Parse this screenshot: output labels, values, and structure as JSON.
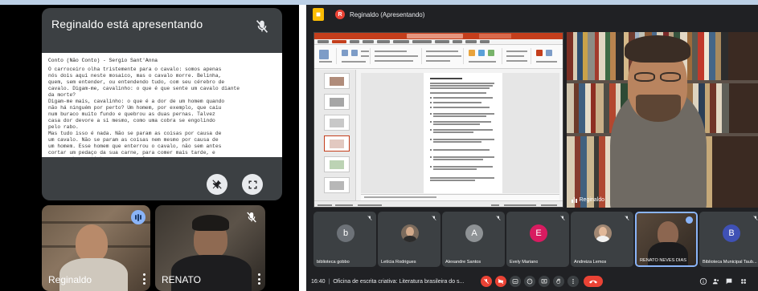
{
  "mobile": {
    "presenter_banner": "Reginaldo está apresentando",
    "document": {
      "title": "Conto (Não Conto) - Sergio Sant'Anna",
      "body": "O carroceiro olha tristemente para o cavalo: somos apenas\nnós dois aqui neste mosaico, mas o cavalo morre. Belinha,\nquem, sem entender, ou entendendo tudo, com seu cérebro de\ncavalo. Digam-me, cavalinho: o que é que sente um cavalo diante\nda morte?\nDigam-me mais, cavalinho: o que é a dor de um homem quando\nnão há ninguém por perto? Um homem, por exemplo, que caiu\nnum buraco muito fundo e quebrou as duas pernas. Talvez\ncasa dor devore a si mesmo, como uma cobra se engolindo\npelo rabo.\nMas tudo isso é nada. Não se param as coisas por causa de\num cavalo. Não se param as coisas nem mesmo por causa de\num homem. Esse homem que enterrou o cavalo, não sem antes\ncortar um pedaço da sua carne, para comer mais tarde, e\nagora o homem tinha que puxar ele mesmo a carroça."
    },
    "tiles": [
      {
        "name": "Reginaldo"
      },
      {
        "name": "RENATO"
      }
    ]
  },
  "desktop": {
    "window_title": "Reginaldo (Apresentando)",
    "main_speaker": "Reginaldo",
    "participants": [
      {
        "name": "biblioteca gobbo",
        "initial": "b",
        "color": "#6d7278"
      },
      {
        "name": "Letícia Rodrigues",
        "initial": "",
        "color": "#7b6b5d"
      },
      {
        "name": "Alexandre Santos",
        "initial": "A",
        "color": "#8e9295"
      },
      {
        "name": "Evely Mariano",
        "initial": "E",
        "color": "#d81b60"
      },
      {
        "name": "Andreiza Lemos",
        "initial": "",
        "color": "#a08773"
      },
      {
        "name": "RENATO NEVES DIAS",
        "initial": "",
        "color": "#4a3f37"
      },
      {
        "name": "Biblioteca Municipal Taub...",
        "initial": "B",
        "color": "#3f51b5"
      }
    ],
    "clock": "16:40",
    "meeting_title": "Oficina de escrita criativa: Literatura brasileira do s..."
  },
  "icons": {
    "mic_off": "mic-off-icon",
    "pin_off": "pin-off-icon",
    "fullscreen": "fullscreen-icon",
    "more": "more-vert-icon",
    "end_call": "call-end-icon"
  }
}
